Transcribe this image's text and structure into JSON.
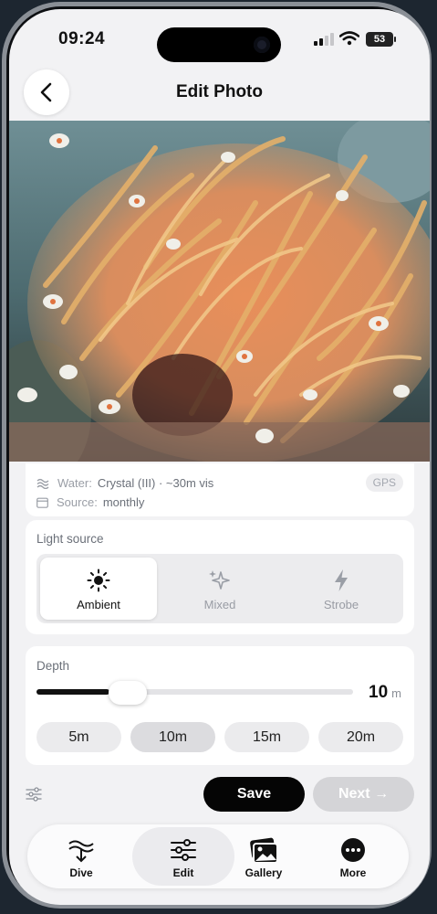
{
  "status_bar": {
    "time": "09:24",
    "battery": "53"
  },
  "nav": {
    "title": "Edit Photo"
  },
  "photo": {
    "subject": "anemone-with-clownfish-photo"
  },
  "meta": {
    "water_label": "Water:",
    "water_value": "Crystal (III) · ~30m vis",
    "source_label": "Source:",
    "source_value": "monthly",
    "badge": "GPS"
  },
  "light_source": {
    "label": "Light source",
    "options": [
      {
        "label": "Ambient",
        "icon": "sun-icon",
        "selected": true
      },
      {
        "label": "Mixed",
        "icon": "sparkles-icon",
        "selected": false
      },
      {
        "label": "Strobe",
        "icon": "lightning-icon",
        "selected": false
      }
    ]
  },
  "depth": {
    "label": "Depth",
    "value": "10",
    "unit": "m",
    "slider_fraction": 0.23,
    "presets": [
      "5m",
      "10m",
      "15m",
      "20m"
    ],
    "selected_preset": "10m"
  },
  "actions": {
    "save": "Save",
    "next": "Next →"
  },
  "tabbar": {
    "items": [
      {
        "label": "Dive",
        "icon": "dive-icon"
      },
      {
        "label": "Edit",
        "icon": "sliders-icon",
        "active": true
      },
      {
        "label": "Gallery",
        "icon": "gallery-icon"
      },
      {
        "label": "More",
        "icon": "more-icon"
      }
    ]
  },
  "colors": {
    "accent": "#050505",
    "disabled": "#d4d4d7",
    "background": "#f2f2f4"
  }
}
